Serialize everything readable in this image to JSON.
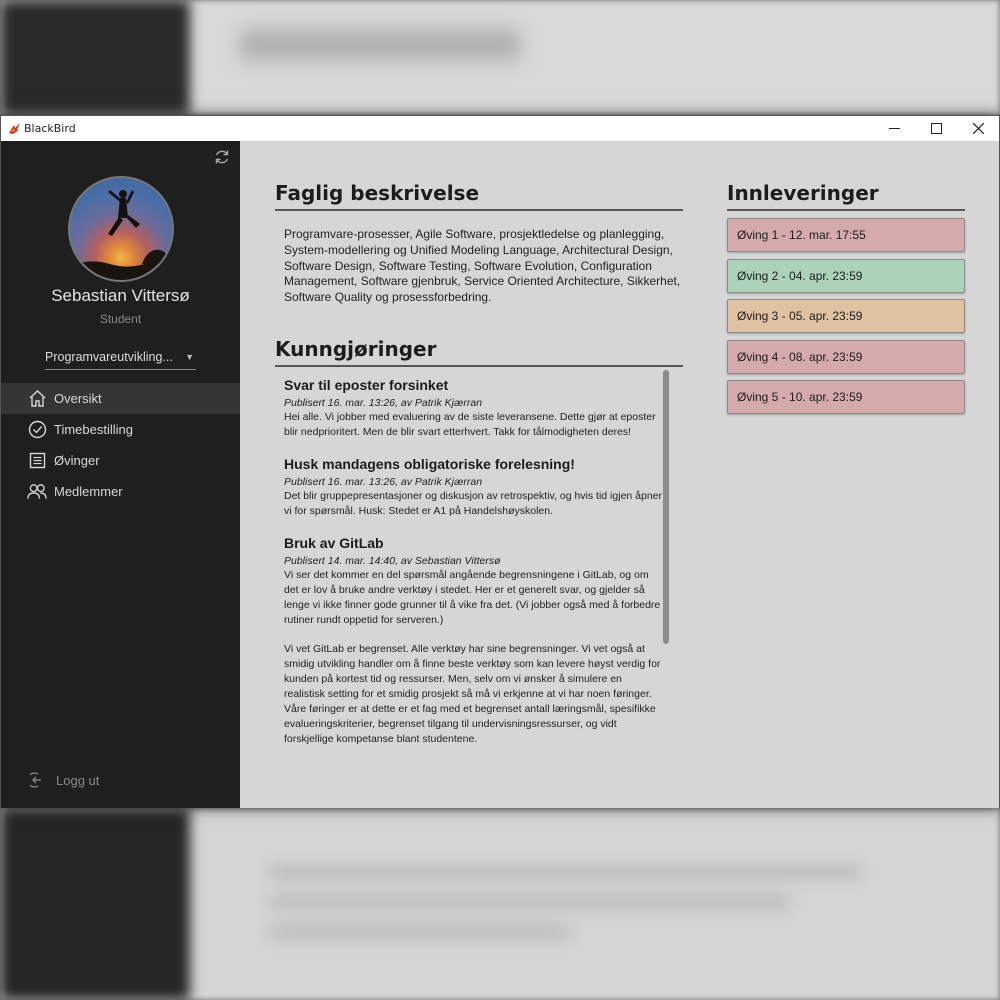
{
  "window": {
    "title": "BlackBird",
    "controls": {
      "minimize": "—",
      "maximize": "☐",
      "close": "✕"
    }
  },
  "sidebar": {
    "user_name": "Sebastian Vittersø",
    "user_role": "Student",
    "course": "Programvareutvikling...",
    "nav": [
      {
        "label": "Oversikt",
        "icon": "home-icon",
        "active": true
      },
      {
        "label": "Timebestilling",
        "icon": "check-circle-icon",
        "active": false
      },
      {
        "label": "Øvinger",
        "icon": "list-icon",
        "active": false
      },
      {
        "label": "Medlemmer",
        "icon": "users-icon",
        "active": false
      }
    ],
    "logout": "Logg ut"
  },
  "description": {
    "title": "Faglig beskrivelse",
    "text": "Programvare-prosesser, Agile Software, prosjektledelse og planlegging, System-modellering og Unified Modeling Language, Architectural Design, Software Design, Software Testing, Software Evolution, Configuration Management, Software gjenbruk, Service Oriented Architecture, Sikkerhet, Software Quality og prosessforbedring."
  },
  "announcements": {
    "title": "Kunngjøringer",
    "items": [
      {
        "title": "Svar til eposter forsinket",
        "meta": "Publisert 16. mar. 13:26, av Patrik Kjærran",
        "body": [
          "Hei alle. Vi jobber med evaluering av de siste leveransene. Dette gjør at eposter blir nedprioritert. Men de blir svart etterhvert. Takk for tålmodigheten deres!"
        ]
      },
      {
        "title": "Husk mandagens obligatoriske forelesning!",
        "meta": "Publisert 16. mar. 13:26, av Patrik Kjærran",
        "body": [
          "Det blir gruppepresentasjoner og diskusjon av retrospektiv, og hvis tid igjen åpner vi for spørsmål. Husk: Stedet er A1 på Handelshøyskolen."
        ]
      },
      {
        "title": "Bruk av GitLab",
        "meta": "Publisert 14. mar. 14:40, av Sebastian Vittersø",
        "body": [
          "Vi ser det kommer en del spørsmål angående begrensningene i GitLab, og om det er lov å bruke andre verktøy i stedet. Her er et generelt svar, og gjelder så lenge vi ikke finner gode grunner til å vike fra det. (Vi jobber også med å forbedre rutiner rundt oppetid for serveren.)",
          "Vi vet GitLab er begrenset. Alle verktøy har sine begrensninger. Vi vet også at smidig utvikling handler om å finne beste verktøy som kan levere høyst verdig for kunden på kortest tid og ressurser. Men, selv om vi ønsker å simulere en realistisk setting for et smidig prosjekt så må vi erkjenne at vi har noen føringer. Våre føringer er at dette er et fag med et begrenset antall læringsmål, spesifikke evalueringskriterier, begrenset tilgang til undervisningsressurser, og vidt forskjellige kompetanse blant studentene."
        ]
      }
    ]
  },
  "deliveries": {
    "title": "Innleveringer",
    "items": [
      {
        "label": "Øving 1 - 12. mar. 17:55",
        "color": "#d4aaac"
      },
      {
        "label": "Øving 2 - 04. apr. 23:59",
        "color": "#acd2ba"
      },
      {
        "label": "Øving 3 - 05. apr. 23:59",
        "color": "#dfc2a1"
      },
      {
        "label": "Øving 4 - 08. apr. 23:59",
        "color": "#d4aaac"
      },
      {
        "label": "Øving 5 - 10. apr. 23:59",
        "color": "#d4aaac"
      }
    ]
  }
}
